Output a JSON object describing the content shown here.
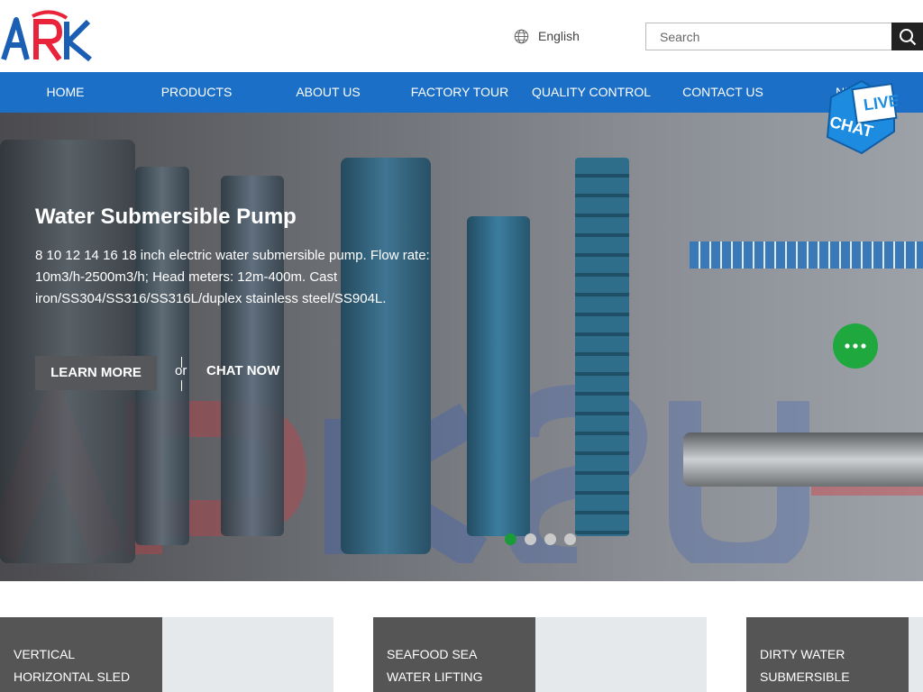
{
  "header": {
    "logo_text": "ARK",
    "language": "English",
    "search_placeholder": "Search"
  },
  "nav": {
    "items": [
      "HOME",
      "PRODUCTS",
      "ABOUT US",
      "FACTORY TOUR",
      "QUALITY CONTROL",
      "CONTACT US",
      "NEWS"
    ]
  },
  "hero": {
    "title": "Water Submersible Pump",
    "description": "8 10 12 14 16 18 inch electric water submersible pump. Flow rate: 10m3/h-2500m3/h; Head meters: 12m-400m. Cast iron/SS304/SS316/SS316L/duplex stainless steel/SS904L.",
    "learn_more": "LEARN MORE",
    "or": "or",
    "chat_now": "CHAT NOW",
    "slides": 4,
    "active_slide": 1
  },
  "live_chat": {
    "line1": "LIVE",
    "line2": "CHAT"
  },
  "cards": [
    {
      "label": "VERTICAL HORIZONTAL SLED"
    },
    {
      "label": "SEAFOOD SEA WATER LIFTING SUBMERSIBLE"
    },
    {
      "label": "DIRTY WATER SUBMERSIBLE"
    }
  ],
  "colors": {
    "nav": "#1b6fc6",
    "accent_green": "#1ea83e",
    "logo_red": "#e8233a",
    "logo_blue": "#1b5fb5"
  }
}
